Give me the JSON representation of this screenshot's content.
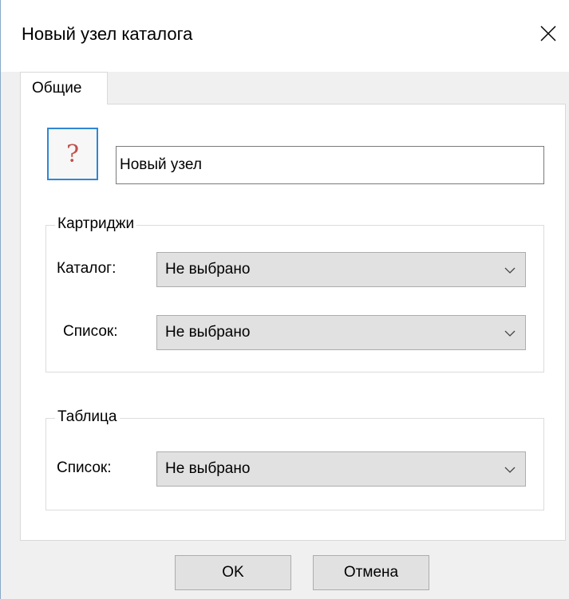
{
  "window": {
    "title": "Новый узел каталога",
    "close_icon": "close-icon"
  },
  "tabs": [
    {
      "label": "Общие",
      "active": true
    }
  ],
  "node": {
    "icon_glyph": "?",
    "icon_name": "question-mark-icon",
    "name_value": "Новый узел"
  },
  "cartridges": {
    "title": "Картриджи",
    "catalog_label": "Каталог:",
    "catalog_value": "Не выбрано",
    "list_label": "Список:",
    "list_value": "Не выбрано"
  },
  "table": {
    "title": "Таблица",
    "list_label": "Список:",
    "list_value": "Не выбрано"
  },
  "buttons": {
    "ok": "OK",
    "cancel": "Отмена"
  },
  "colors": {
    "focus_border": "#2f87d4",
    "icon_glyph": "#c0504d",
    "button_face": "#e1e1e1"
  }
}
